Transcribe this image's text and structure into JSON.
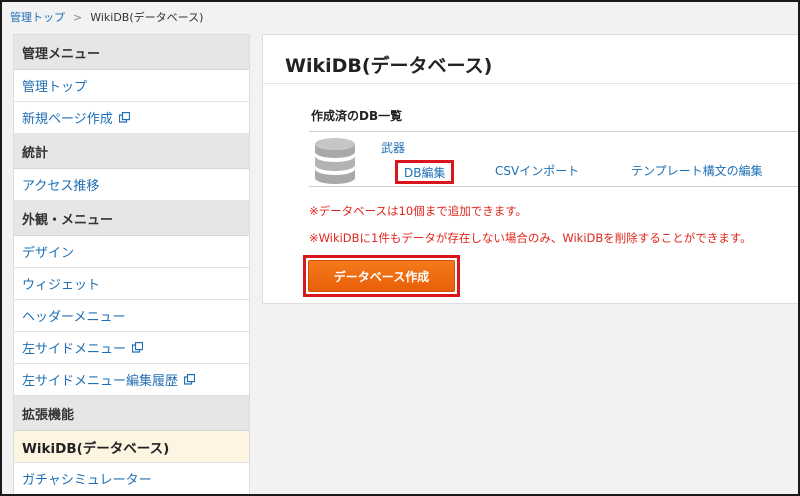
{
  "breadcrumb": {
    "home": "管理トップ",
    "separator": ">",
    "current": "WikiDB(データベース)"
  },
  "sidebar": {
    "sections": [
      {
        "title": "管理メニュー",
        "items": [
          {
            "label": "管理トップ"
          },
          {
            "label": "新規ページ作成",
            "external": true
          }
        ]
      },
      {
        "title": "統計",
        "items": [
          {
            "label": "アクセス推移"
          }
        ]
      },
      {
        "title": "外観・メニュー",
        "items": [
          {
            "label": "デザイン"
          },
          {
            "label": "ウィジェット"
          },
          {
            "label": "ヘッダーメニュー"
          },
          {
            "label": "左サイドメニュー",
            "external": true
          },
          {
            "label": "左サイドメニュー編集履歴",
            "external": true
          }
        ]
      },
      {
        "title": "拡張機能",
        "items": [
          {
            "label": "WikiDB(データベース)",
            "active": true
          },
          {
            "label": "ガチャシミュレーター"
          }
        ]
      }
    ]
  },
  "main": {
    "title": "WikiDB(データベース)",
    "db_list_title": "作成済のDB一覧",
    "db": {
      "name": "武器",
      "edit_label": "DB編集",
      "csv_label": "CSVインポート",
      "template_label": "テンプレート構文の編集"
    },
    "notes": [
      "※データベースは10個まで追加できます。",
      "※WikiDBに1件もデータが存在しない場合のみ、WikiDBを削除することができます。"
    ],
    "create_button": "データベース作成"
  },
  "colors": {
    "link": "#1f6fb5",
    "note": "#e0261e",
    "button": "#ef6a0f",
    "highlight": "#d9161d",
    "active_bg": "#fdf5e2"
  },
  "icons": {
    "external": "external-link-icon",
    "database": "database-icon"
  }
}
